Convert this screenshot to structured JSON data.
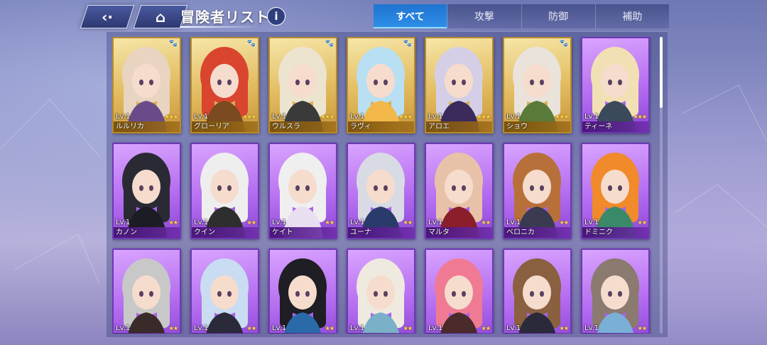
{
  "header": {
    "title": "冒険者リスト",
    "back_icon": "back-arrow-icon",
    "home_icon": "home-icon",
    "info_label": "i"
  },
  "tabs": [
    {
      "label": "すべて",
      "active": true
    },
    {
      "label": "攻撃",
      "active": false
    },
    {
      "label": "防御",
      "active": false
    },
    {
      "label": "補助",
      "active": false
    }
  ],
  "colors": {
    "gold_frame": "#b88a2a",
    "purple_frame": "#6e38b6",
    "active_tab": "#1f74d0"
  },
  "adventurers": [
    {
      "name": "ルルリカ",
      "level": "Lv.1",
      "stars": "★★★",
      "rarity": "gold",
      "paw": "🐾",
      "hair": "#e8d4c0",
      "accent": "#6b4a8a"
    },
    {
      "name": "グローリア",
      "level": "Lv.1",
      "stars": "★★★",
      "rarity": "gold",
      "paw": "🐾",
      "hair": "#d9452e",
      "accent": "#7a4a20"
    },
    {
      "name": "ウルスラ",
      "level": "Lv.1",
      "stars": "★★★",
      "rarity": "gold",
      "paw": "🐾",
      "hair": "#ece4cf",
      "accent": "#3a3a3a"
    },
    {
      "name": "ラヴィ",
      "level": "Lv.1",
      "stars": "★★★",
      "rarity": "gold",
      "paw": "🐾",
      "hair": "#b9dff2",
      "accent": "#f2b84a"
    },
    {
      "name": "アロエ",
      "level": "Lv.1",
      "stars": "★★★",
      "rarity": "gold",
      "paw": "",
      "hair": "#d4cfe6",
      "accent": "#3b2a5c"
    },
    {
      "name": "ショウ",
      "level": "Lv.1",
      "stars": "★★★",
      "rarity": "gold",
      "paw": "🐾",
      "hair": "#e9e3dc",
      "accent": "#5a7a3a"
    },
    {
      "name": "ティーネ",
      "level": "Lv.1",
      "stars": "★★★",
      "rarity": "purple",
      "paw": "",
      "hair": "#f2e0b5",
      "accent": "#3a4a5a"
    },
    {
      "name": "カノン",
      "level": "Lv.1",
      "stars": "★★",
      "rarity": "purple",
      "paw": "",
      "hair": "#2a2a35",
      "accent": "#1c1c24"
    },
    {
      "name": "クイン",
      "level": "Lv.1",
      "stars": "★★",
      "rarity": "purple",
      "paw": "",
      "hair": "#eeeeee",
      "accent": "#2e2e2e"
    },
    {
      "name": "ケイト",
      "level": "Lv.1",
      "stars": "★★",
      "rarity": "purple",
      "paw": "",
      "hair": "#efefef",
      "accent": "#e8dff0"
    },
    {
      "name": "ユーナ",
      "level": "Lv.1",
      "stars": "★★",
      "rarity": "purple",
      "paw": "",
      "hair": "#d8dbe4",
      "accent": "#2a3a6a"
    },
    {
      "name": "マルタ",
      "level": "Lv.1",
      "stars": "★★",
      "rarity": "purple",
      "paw": "",
      "hair": "#e8c2a8",
      "accent": "#8a1e2a"
    },
    {
      "name": "ベロニカ",
      "level": "Lv.1",
      "stars": "★★",
      "rarity": "purple",
      "paw": "",
      "hair": "#b8703a",
      "accent": "#3a3a50"
    },
    {
      "name": "ドミニク",
      "level": "Lv.1",
      "stars": "★★",
      "rarity": "purple",
      "paw": "",
      "hair": "#f08a2a",
      "accent": "#3a8a6a"
    },
    {
      "name": "",
      "level": "Lv.1",
      "stars": "★★",
      "rarity": "purple",
      "paw": "",
      "hair": "#c8c8c8",
      "accent": "#3a2a2a"
    },
    {
      "name": "",
      "level": "Lv.1",
      "stars": "★★",
      "rarity": "purple",
      "paw": "",
      "hair": "#c9dcf2",
      "accent": "#2a2a3a"
    },
    {
      "name": "",
      "level": "Lv.1",
      "stars": "★★",
      "rarity": "purple",
      "paw": "",
      "hair": "#1e1e24",
      "accent": "#2a6aa8"
    },
    {
      "name": "",
      "level": "Lv.1",
      "stars": "★★",
      "rarity": "purple",
      "paw": "",
      "hair": "#eeeae0",
      "accent": "#7ab0c8"
    },
    {
      "name": "",
      "level": "Lv.1",
      "stars": "★★",
      "rarity": "purple",
      "paw": "",
      "hair": "#f07a94",
      "accent": "#4a2a2a"
    },
    {
      "name": "",
      "level": "Lv.1",
      "stars": "★★",
      "rarity": "purple",
      "paw": "",
      "hair": "#8a6040",
      "accent": "#2a2a3a"
    },
    {
      "name": "",
      "level": "Lv.1",
      "stars": "★★",
      "rarity": "purple",
      "paw": "",
      "hair": "#8a7a70",
      "accent": "#7ab0d8"
    }
  ]
}
